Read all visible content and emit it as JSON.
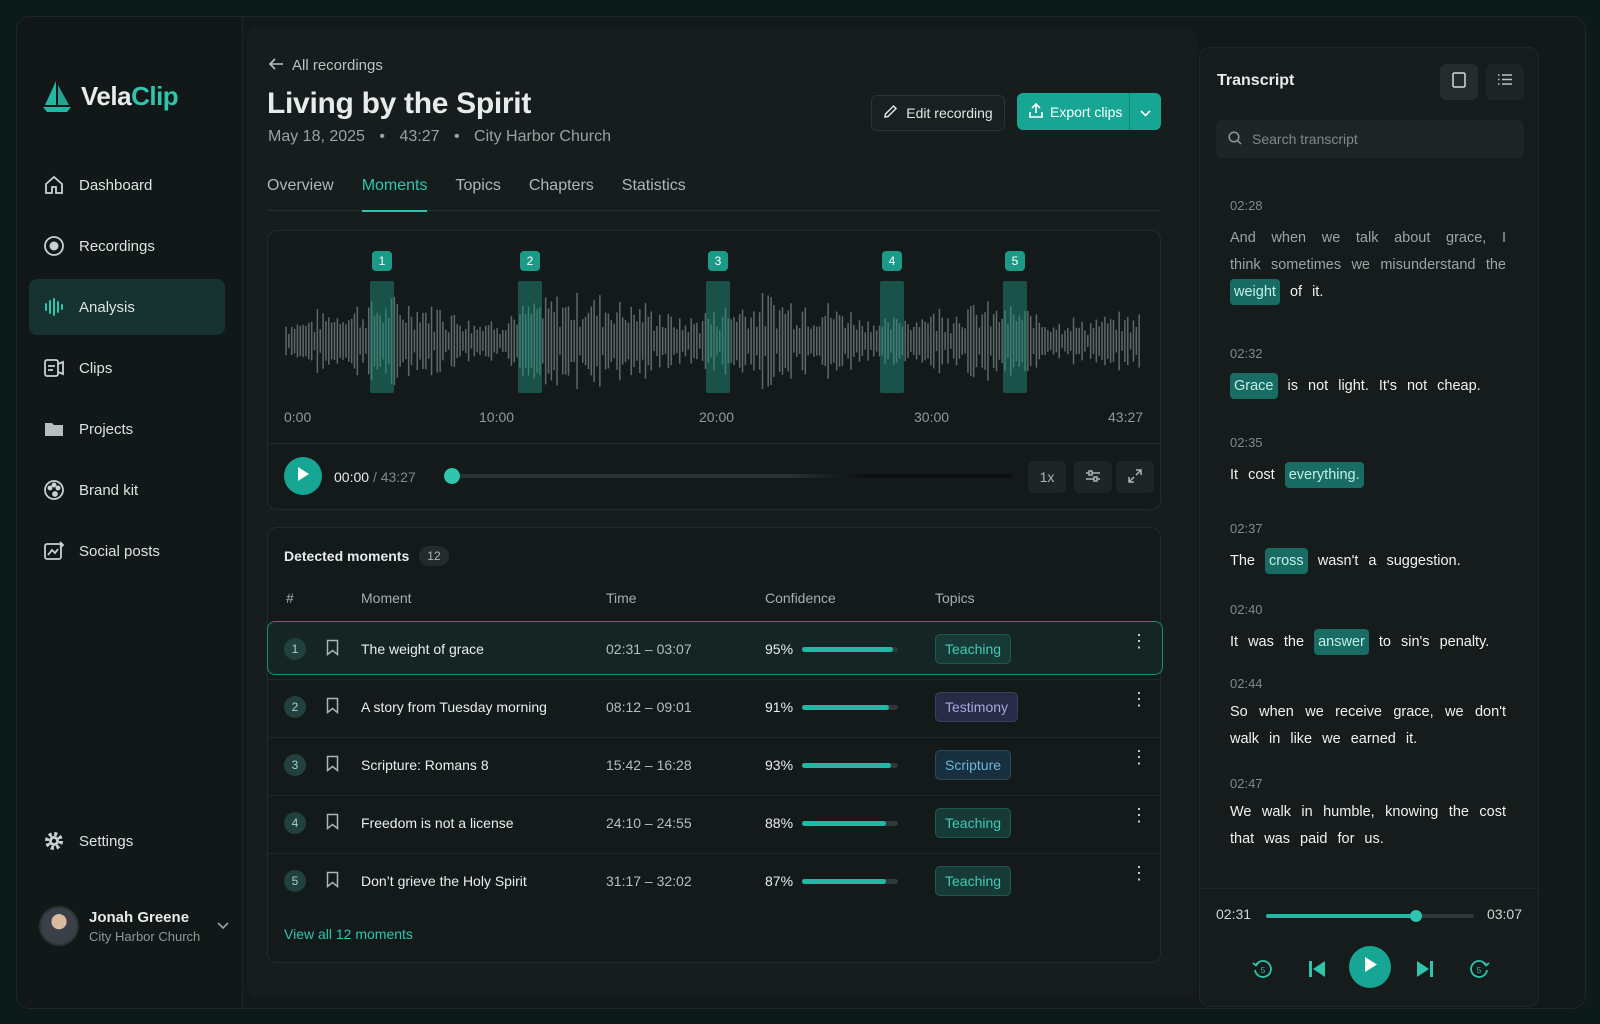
{
  "app": {
    "name_part1": "Vela",
    "name_part2": "Clip",
    "accent": "#2ec4ae"
  },
  "sidebar": {
    "items": [
      {
        "label": "Dashboard",
        "icon": "home-icon"
      },
      {
        "label": "Recordings",
        "icon": "record-icon"
      },
      {
        "label": "Analysis",
        "icon": "waveform-icon",
        "active": true
      },
      {
        "label": "Clips",
        "icon": "clips-icon"
      },
      {
        "label": "Projects",
        "icon": "folder-icon"
      },
      {
        "label": "Brand kit",
        "icon": "palette-icon"
      },
      {
        "label": "Social posts",
        "icon": "social-icon"
      }
    ],
    "settings": "Settings",
    "user": {
      "name": "Jonah Greene",
      "org": "City Harbor Church"
    }
  },
  "header": {
    "back": "All recordings",
    "title": "Living by the Spirit",
    "date": "May 18, 2025",
    "duration": "43:27",
    "location": "City Harbor Church",
    "edit_label": "Edit recording",
    "export_label": "Export clips"
  },
  "tabs": [
    "Overview",
    "Moments",
    "Topics",
    "Chapters",
    "Statistics"
  ],
  "active_tab": "Moments",
  "waveform": {
    "markers": [
      "1",
      "2",
      "3",
      "4",
      "5"
    ],
    "ticks": [
      "0:00",
      "10:00",
      "20:00",
      "30:00",
      "43:27"
    ],
    "current": "00:00",
    "total": "/ 43:27",
    "speed": "1x",
    "progress": 0
  },
  "moments": {
    "title": "Detected moments",
    "count": "12",
    "columns": {
      "num": "#",
      "moment": "Moment",
      "time": "Time",
      "confidence": "Confidence",
      "topics": "Topics"
    },
    "rows": [
      {
        "num": "1",
        "name": "The weight of grace",
        "time": "02:31 – 03:07",
        "confidence": "95%",
        "conf_value": 0.95,
        "topic": "Teaching",
        "topic_kind": "teaching"
      },
      {
        "num": "2",
        "name": "A story from Tuesday morning",
        "time": "08:12 – 09:01",
        "confidence": "91%",
        "conf_value": 0.91,
        "topic": "Testimony",
        "topic_kind": "testimony"
      },
      {
        "num": "3",
        "name": "Scripture: Romans 8",
        "time": "15:42 – 16:28",
        "confidence": "93%",
        "conf_value": 0.93,
        "topic": "Scripture",
        "topic_kind": "scripture"
      },
      {
        "num": "4",
        "name": "Freedom is not a license",
        "time": "24:10 – 24:55",
        "confidence": "88%",
        "conf_value": 0.88,
        "topic": "Teaching",
        "topic_kind": "teaching"
      },
      {
        "num": "5",
        "name": "Don’t grieve the Holy Spirit",
        "time": "31:17 – 32:02",
        "confidence": "87%",
        "conf_value": 0.87,
        "topic": "Teaching",
        "topic_kind": "teaching"
      }
    ],
    "view_all": "View all 12 moments"
  },
  "transcript": {
    "title": "Transcript",
    "search_placeholder": "Search transcript",
    "segments": [
      {
        "time": "02:28"
      },
      {
        "time": "02:32"
      },
      {
        "time": "02:35"
      },
      {
        "time": "02:37"
      },
      {
        "time": "02:40"
      },
      {
        "time": "02:44"
      },
      {
        "time": "02:47"
      }
    ],
    "text": {
      "s1a": "And when we talk about grace, I think sometimes we misunderstand the",
      "s1h": "weight",
      "s1b": "of it.",
      "s2h": "Grace",
      "s2b": "is not light. It's not cheap.",
      "s3a": "It cost",
      "s3h": "everything.",
      "s4a": "The",
      "s4h": "cross",
      "s4b": "wasn't a suggestion.",
      "s5a": "It was the",
      "s5h": "answer",
      "s5b": "to sin's penalty.",
      "s6a": "So when we receive grace, we don't walk in like we earned it.",
      "s7a": "We walk in humble, knowing the cost that was paid for us."
    },
    "player": {
      "start": "02:31",
      "end": "03:07",
      "progress": 0.72
    }
  }
}
